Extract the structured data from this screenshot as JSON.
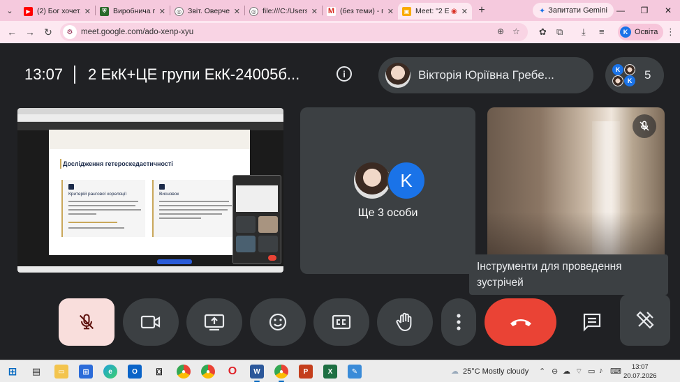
{
  "browser": {
    "tabs": [
      {
        "title": "(2) Бог хочет, ч",
        "favicon": "youtube-icon",
        "color": "#ff0000"
      },
      {
        "title": "Виробнича пра",
        "favicon": "shield-crest-icon",
        "color": "#2b6a2b"
      },
      {
        "title": "Звіт. Оверчен",
        "favicon": "globe-icon",
        "color": "#666666"
      },
      {
        "title": "file:///C:/Users/",
        "favicon": "globe-icon",
        "color": "#666666"
      },
      {
        "title": "(без теми) - па",
        "favicon": "gmail-icon",
        "color": "#d93025"
      },
      {
        "title": "Meet: \"2 Ек",
        "favicon": "meet-icon",
        "color": "#f9ab00"
      }
    ],
    "new_tab": "+",
    "gemini_label": "Запитати Gemini",
    "url": "meet.google.com/ado-xenp-xyu",
    "profile_initial": "K",
    "profile_label": "Освіта"
  },
  "meet": {
    "time": "13:07",
    "title": "2 ЕкК+ЦЕ групи ЕкК-24005б...",
    "presenter_name": "Вікторія Юріївна Гребе...",
    "participants_count": "5",
    "participants_initial": "K",
    "more_label": "Ще 3 особи",
    "more_initial": "K",
    "slide": {
      "title": "Дослідження гетероскедастичності",
      "card1_title": "Критерій рангової кореляції",
      "card2_title": "Висновок"
    },
    "tooltip": "Інструменти для проведення зустрічей",
    "controls": [
      {
        "name": "mic-off-button",
        "icon": "mic-off-icon"
      },
      {
        "name": "camera-button",
        "icon": "camera-icon"
      },
      {
        "name": "present-button",
        "icon": "present-icon"
      },
      {
        "name": "reactions-button",
        "icon": "emoji-icon"
      },
      {
        "name": "captions-button",
        "icon": "captions-icon"
      },
      {
        "name": "raise-hand-button",
        "icon": "hand-icon"
      },
      {
        "name": "more-options-button",
        "icon": "more-vert-icon"
      },
      {
        "name": "leave-call-button",
        "icon": "call-end-icon"
      },
      {
        "name": "chat-button",
        "icon": "chat-icon"
      },
      {
        "name": "tools-button",
        "icon": "tools-icon"
      }
    ],
    "colors": {
      "end_call": "#ea4335",
      "mic_off_bg": "#f9dedc",
      "accent_blue": "#1a73e8"
    }
  },
  "taskbar": {
    "weather": "25°C  Mostly cloudy",
    "time": "13:07",
    "date": "20.07.2026"
  }
}
